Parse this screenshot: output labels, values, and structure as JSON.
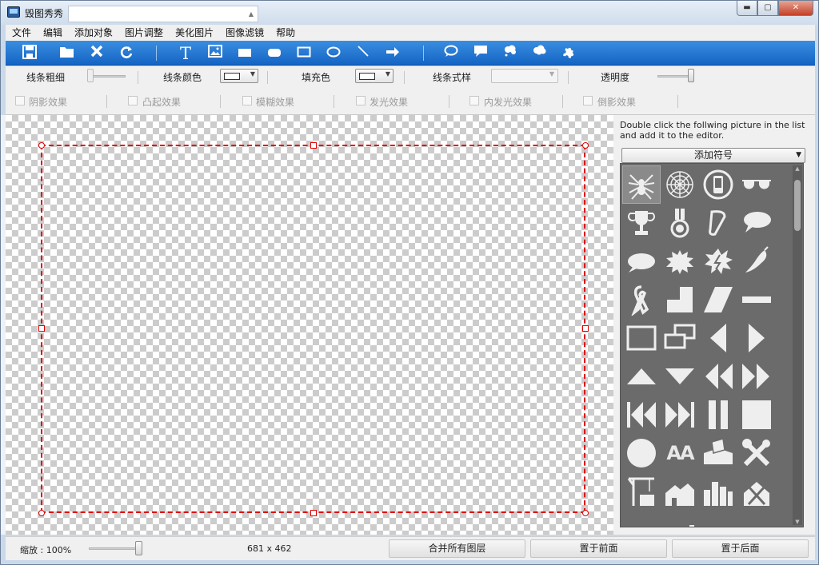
{
  "window": {
    "title": "毁图秀秀",
    "title_input_value": "",
    "controls": {
      "minimize": "▬",
      "maximize": "▢",
      "close": "✕"
    }
  },
  "menu": [
    "文件",
    "编辑",
    "添加对象",
    "图片调整",
    "美化图片",
    "图像滤镜",
    "帮助"
  ],
  "toolbar": {
    "icons": [
      "save-icon",
      "open-folder-icon",
      "delete-icon",
      "redo-icon",
      "text-icon",
      "image-icon",
      "filled-rectangle-icon",
      "filled-rounded-rect-icon",
      "rectangle-icon",
      "ellipse-icon",
      "line-icon",
      "arrow-icon",
      "speech-bubble-icon",
      "callout-icon",
      "thought-bubble-icon",
      "cloud-callout-icon",
      "puzzle-icon"
    ]
  },
  "properties": {
    "line_width_label": "线条粗细",
    "line_color_label": "线条颜色",
    "fill_color_label": "填充色",
    "line_style_label": "线条式样",
    "line_style_value": "",
    "opacity_label": "透明度",
    "effects": [
      "阴影效果",
      "凸起效果",
      "模糊效果",
      "发光效果",
      "内发光效果",
      "倒影效果"
    ]
  },
  "right_panel": {
    "hint": "Double click the follwing picture in the list and add it to the editor.",
    "dropdown_value": "添加符号"
  },
  "status": {
    "zoom_label": "缩放 : 100%",
    "zoom_percent": 100,
    "size_label": "681 x 462",
    "buttons": [
      "合并所有图层",
      "置于前面",
      "置于后面"
    ]
  }
}
